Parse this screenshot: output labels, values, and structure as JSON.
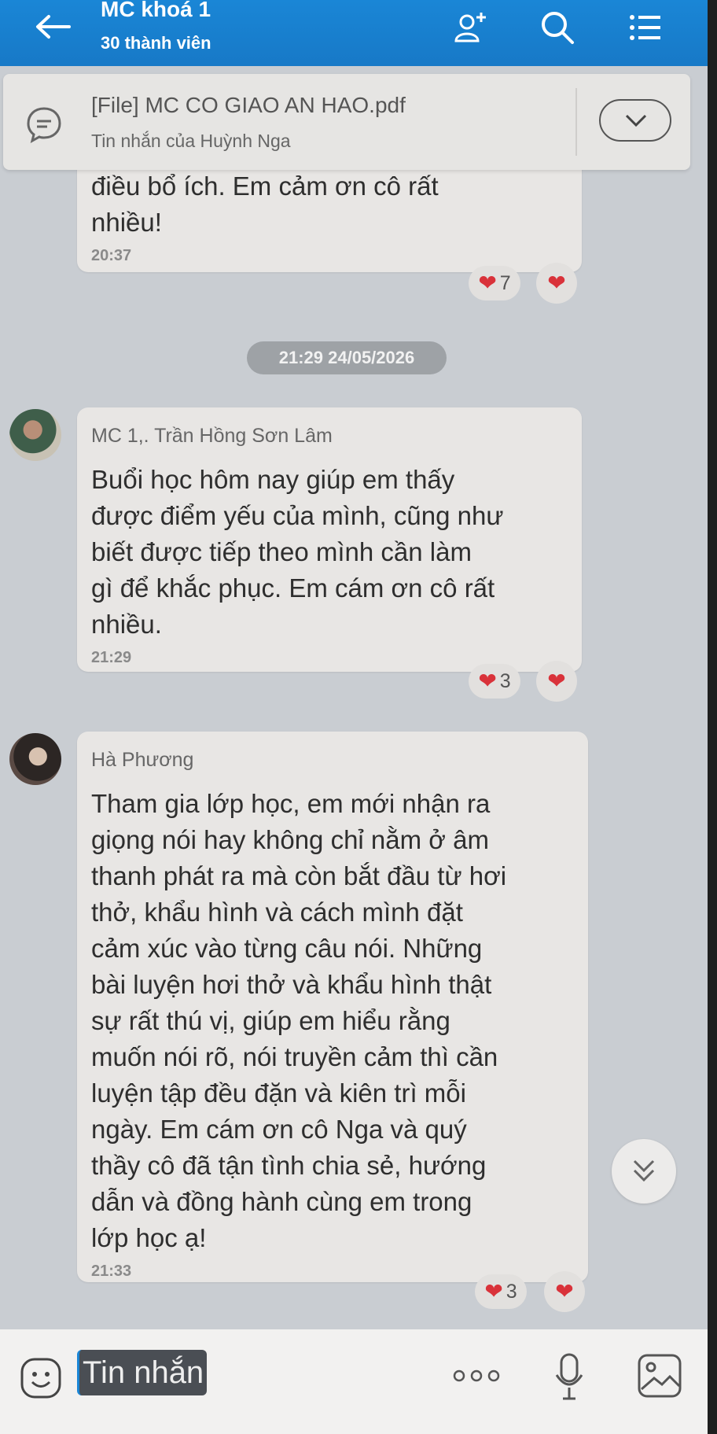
{
  "header": {
    "title": "MC khoá 1",
    "subtitle": "30 thành viên"
  },
  "pinned": {
    "title": "[File] MC CO GIAO AN HAO.pdf",
    "subtitle": "Tin nhắn của Huỳnh Nga"
  },
  "messages": [
    {
      "text_lines": [
        "điều bổ ích. Em cảm ơn cô rất",
        "nhiều!"
      ],
      "time": "20:37",
      "reaction_count": "7"
    },
    {
      "sender": "MC 1,. Trần Hồng Sơn Lâm",
      "text_lines": [
        "Buổi học hôm nay giúp em thấy",
        "được điểm yếu của mình, cũng như",
        "biết được tiếp theo mình cần làm",
        "gì để khắc phục. Em cám ơn cô rất",
        "nhiều."
      ],
      "time": "21:29",
      "reaction_count": "3"
    },
    {
      "sender": "Hà Phương",
      "text_lines": [
        "Tham gia lớp học, em mới nhận ra",
        "giọng nói hay không chỉ nằm ở âm",
        "thanh phát ra mà còn bắt đầu từ hơi",
        "thở, khẩu hình và cách mình đặt",
        "cảm xúc vào từng câu nói. Những",
        "bài luyện hơi thở và khẩu hình thật",
        "sự rất thú vị, giúp em hiểu rằng",
        "muốn nói rõ, nói truyền cảm thì cần",
        "luyện tập đều đặn và kiên trì mỗi",
        "ngày. Em cám ơn cô Nga và quý",
        "thầy cô đã tận tình chia sẻ, hướng",
        "dẫn và đồng hành cùng em trong",
        "lớp học ạ!"
      ],
      "time": "21:33",
      "reaction_count": "3"
    }
  ],
  "date_separator": "21:29 24/05/2026",
  "composer": {
    "placeholder": "Tin nhắn"
  },
  "icons": {
    "back": "arrow-left-icon",
    "add_member": "add-member-icon",
    "search": "search-icon",
    "menu": "list-menu-icon",
    "pinned": "message-icon",
    "expand": "chevron-down-icon",
    "reaction": "heart-icon",
    "scroll_down": "double-chevron-down-icon",
    "emoji": "emoji-icon",
    "more": "more-icon",
    "mic": "microphone-icon",
    "image": "image-icon"
  },
  "colors": {
    "header": "#1a86d6",
    "background": "#c9cdd2",
    "bubble": "#e8e6e4",
    "heart": "#d9323a"
  }
}
